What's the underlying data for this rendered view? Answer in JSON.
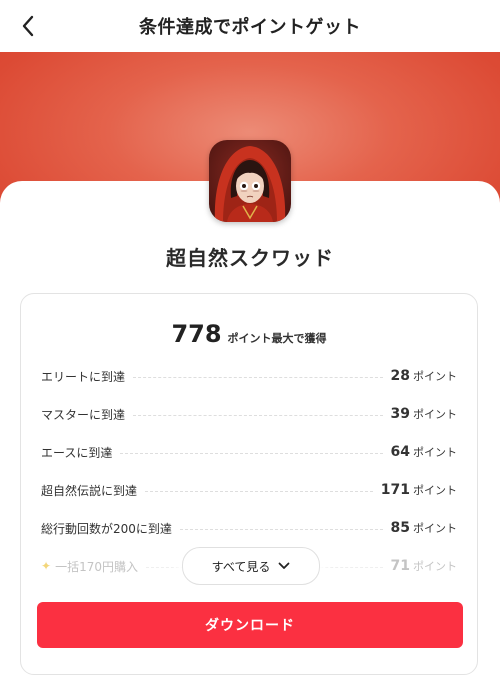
{
  "header": {
    "title": "条件達成でポイントゲット",
    "back_icon": "chevron-left-icon"
  },
  "colors": {
    "banner": "#DC4A34",
    "download_button": "#FB3041",
    "sparkle": "#F3D67A"
  },
  "game": {
    "title": "超自然スクワッド",
    "icon": "game-character-icon"
  },
  "summary": {
    "total_points": "778",
    "label": "ポイント最大で獲得"
  },
  "tasks": [
    {
      "label": "エリートに到達",
      "points": "28",
      "unit": "ポイント"
    },
    {
      "label": "マスターに到達",
      "points": "39",
      "unit": "ポイント"
    },
    {
      "label": "エースに到達",
      "points": "64",
      "unit": "ポイント"
    },
    {
      "label": "超自然伝説に到達",
      "points": "171",
      "unit": "ポイント"
    },
    {
      "label": "総行動回数が200に到達",
      "points": "85",
      "unit": "ポイント"
    },
    {
      "label": "一括170円購入",
      "points": "71",
      "unit": "ポイント"
    }
  ],
  "see_all": {
    "label": "すべて見る"
  },
  "download": {
    "label": "ダウンロード"
  }
}
